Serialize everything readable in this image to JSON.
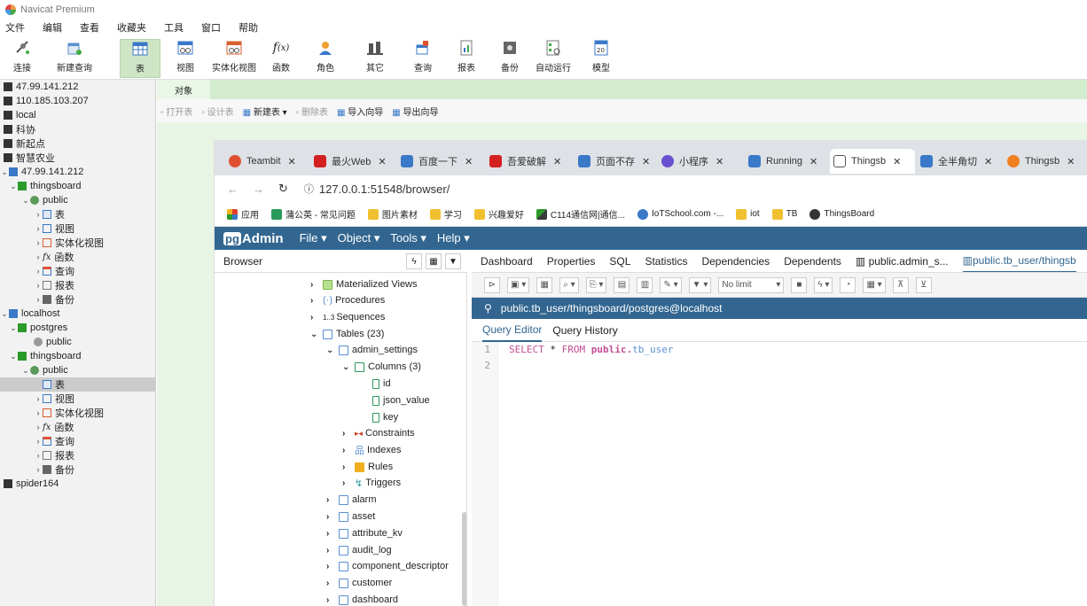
{
  "navicat": {
    "title": "Navicat Premium",
    "menu": [
      "文件",
      "编辑",
      "查看",
      "收藏夹",
      "工具",
      "窗口",
      "帮助"
    ],
    "toolbar": [
      {
        "label": "连接",
        "icon": "connection-icon"
      },
      {
        "label": "新建查询",
        "icon": "new-query-icon"
      },
      {
        "label": "表",
        "icon": "table-icon"
      },
      {
        "label": "视图",
        "icon": "view-icon"
      },
      {
        "label": "实体化视图",
        "icon": "materialized-view-icon"
      },
      {
        "label": "函数",
        "icon": "function-icon"
      },
      {
        "label": "角色",
        "icon": "role-icon"
      },
      {
        "label": "其它",
        "icon": "other-icon"
      },
      {
        "label": "查询",
        "icon": "query-icon"
      },
      {
        "label": "报表",
        "icon": "report-icon"
      },
      {
        "label": "备份",
        "icon": "backup-icon"
      },
      {
        "label": "自动运行",
        "icon": "automation-icon"
      },
      {
        "label": "模型",
        "icon": "model-icon"
      }
    ],
    "tree": [
      {
        "label": "47.99.141.212"
      },
      {
        "label": "110.185.103.207"
      },
      {
        "label": "local"
      },
      {
        "label": "科协"
      },
      {
        "label": "新起点"
      },
      {
        "label": "智慧农业"
      },
      {
        "label": "47.99.141.212"
      },
      {
        "label": "thingsboard"
      },
      {
        "label": "public"
      },
      {
        "label": "表"
      },
      {
        "label": "视图"
      },
      {
        "label": "实体化视图"
      },
      {
        "label": "函数"
      },
      {
        "label": "查询"
      },
      {
        "label": "报表"
      },
      {
        "label": "备份"
      },
      {
        "label": "localhost"
      },
      {
        "label": "postgres"
      },
      {
        "label": "public"
      },
      {
        "label": "thingsboard"
      },
      {
        "label": "public"
      },
      {
        "label": "表"
      },
      {
        "label": "视图"
      },
      {
        "label": "实体化视图"
      },
      {
        "label": "函数"
      },
      {
        "label": "查询"
      },
      {
        "label": "报表"
      },
      {
        "label": "备份"
      },
      {
        "label": "spider164"
      }
    ],
    "object_tab": "对象",
    "actions": [
      "打开表",
      "设计表",
      "新建表",
      "删除表",
      "导入向导",
      "导出向导"
    ]
  },
  "browser": {
    "tabs": [
      {
        "title": "Teambit"
      },
      {
        "title": "最火Web"
      },
      {
        "title": "百度一下"
      },
      {
        "title": "吾爱破解"
      },
      {
        "title": "页面不存"
      },
      {
        "title": "小程序"
      },
      {
        "title": "Running"
      },
      {
        "title": "Thingsb"
      },
      {
        "title": "全半角切"
      },
      {
        "title": "Thingsb"
      }
    ],
    "url": "127.0.0.1:51548/browser/",
    "bookmarks": [
      "应用",
      "蒲公英 - 常见问题",
      "图片素材",
      "学习",
      "兴趣爱好",
      "C114通信网|通信...",
      "IoTSchool.com -...",
      "iot",
      "TB",
      "ThingsBoard"
    ]
  },
  "pgadmin": {
    "logo_pg": "pg",
    "logo_rest": "Admin",
    "menu": [
      "File",
      "Object",
      "Tools",
      "Help"
    ],
    "browser_title": "Browser",
    "tree": [
      {
        "label": "Materialized Views"
      },
      {
        "label": "Procedures"
      },
      {
        "label": "Sequences"
      },
      {
        "label": "Tables (23)"
      },
      {
        "label": "admin_settings"
      },
      {
        "label": "Columns (3)"
      },
      {
        "label": "id"
      },
      {
        "label": "json_value"
      },
      {
        "label": "key"
      },
      {
        "label": "Constraints"
      },
      {
        "label": "Indexes"
      },
      {
        "label": "Rules"
      },
      {
        "label": "Triggers"
      },
      {
        "label": "alarm"
      },
      {
        "label": "asset"
      },
      {
        "label": "attribute_kv"
      },
      {
        "label": "audit_log"
      },
      {
        "label": "component_descriptor"
      },
      {
        "label": "customer"
      },
      {
        "label": "dashboard"
      }
    ],
    "main_tabs": [
      "Dashboard",
      "Properties",
      "SQL",
      "Statistics",
      "Dependencies",
      "Dependents",
      "public.admin_s...",
      "public.tb_user/thingsb"
    ],
    "limit": "No limit",
    "connection": "public.tb_user/thingsboard/postgres@localhost",
    "editor_tabs": [
      "Query Editor",
      "Query History"
    ],
    "lines": [
      "1",
      "2"
    ],
    "sql_kw1": "SELECT",
    "sql_star": " * ",
    "sql_kw2": "FROM",
    "sql_schema": " public.",
    "sql_table": "tb_user"
  }
}
